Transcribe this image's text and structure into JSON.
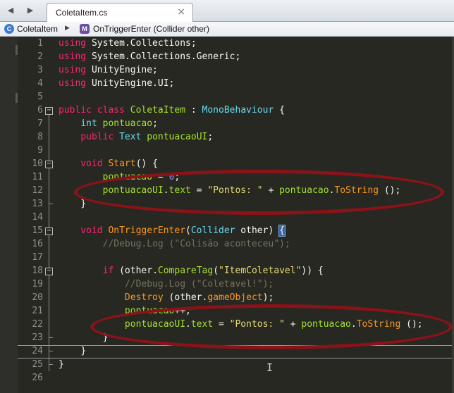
{
  "tab": {
    "title": "ColetaItem.cs",
    "close": "×"
  },
  "nav": {
    "back": "◀",
    "forward": "▶"
  },
  "breadcrumb": {
    "class_name": "ColetaItem",
    "separator": "▶",
    "method_name": "OnTriggerEnter (Collider other)"
  },
  "icons": {
    "class": "class-icon",
    "method": "method-icon"
  },
  "editor": {
    "line_numbers": [
      "1",
      "2",
      "3",
      "4",
      "5",
      "6",
      "7",
      "8",
      "9",
      "10",
      "11",
      "12",
      "13",
      "14",
      "15",
      "16",
      "17",
      "18",
      "19",
      "20",
      "21",
      "22",
      "23",
      "24",
      "25",
      "26"
    ],
    "fold_open": "−",
    "current_line": 24
  },
  "colors": {
    "background": "#272822",
    "keyword": "#f92672",
    "type": "#66d9ef",
    "call": "#a6e22e",
    "string": "#e6db74",
    "number": "#ae81ff",
    "comment": "#75715e",
    "highlight_ellipse": "#8b1219"
  },
  "code": {
    "l1": {
      "kw": "using",
      "rest": " System.Collections;"
    },
    "l2": {
      "kw": "using",
      "rest": " System.Collections.Generic;"
    },
    "l3": {
      "kw": "using",
      "rest": " UnityEngine;"
    },
    "l4": {
      "kw": "using",
      "rest": " UnityEngine.UI;"
    },
    "l6": {
      "kw1": "public",
      "kw2": " class",
      "sp": " ",
      "name": "ColetaItem",
      "colon": " : ",
      "base": "MonoBehaviour",
      "brace": " {"
    },
    "l7": {
      "indent": "    ",
      "type": "int",
      "sp": " ",
      "field": "pontuacao",
      "end": ";"
    },
    "l8": {
      "indent": "    ",
      "kw": "public",
      "sp": " ",
      "type": "Text",
      "sp2": " ",
      "field": "pontuacaoUI",
      "end": ";"
    },
    "l10": {
      "indent": "    ",
      "type": "void",
      "sp": " ",
      "name": "Start",
      "rest": "() {"
    },
    "l11": {
      "indent": "        ",
      "field": "pontuacao",
      "op": " = ",
      "num": "0",
      "end": ";"
    },
    "l12": {
      "indent": "        ",
      "field": "pontuacaoUI",
      "dot": ".",
      "prop": "text",
      "op": " = ",
      "str": "\"Pontos: \"",
      "plus": " + ",
      "field2": "pontuacao",
      "dot2": ".",
      "call": "ToString",
      "end": " ();"
    },
    "l13": {
      "indent": "    ",
      "text": "}"
    },
    "l15": {
      "indent": "    ",
      "type": "void",
      "sp": " ",
      "name": "OnTriggerEnter",
      "open": "(",
      "ptype": "Collider",
      "param": " other",
      "close": ") ",
      "brace": "{"
    },
    "l16": {
      "indent": "        ",
      "comment": "//Debug.Log (\"Colisão aconteceu\");"
    },
    "l18": {
      "indent": "        ",
      "kw": "if",
      "pre": " (other.",
      "call": "CompareTag",
      "open": "(",
      "str": "\"ItemColetavel\"",
      "end": ")) {"
    },
    "l19": {
      "indent": "            ",
      "comment": "//Debug.Log (\"Coletavel!\");"
    },
    "l20": {
      "indent": "            ",
      "call": "Destroy",
      "pre": " (other.",
      "prop": "gameObject",
      "end": ");"
    },
    "l21": {
      "indent": "            ",
      "field": "pontuacao",
      "end": "++;"
    },
    "l22": {
      "indent": "            ",
      "field": "pontuacaoUI",
      "dot": ".",
      "prop": "text",
      "op": " = ",
      "str": "\"Pontos: \"",
      "plus": " + ",
      "field2": "pontuacao",
      "dot2": ".",
      "call": "ToString",
      "end": " ();"
    },
    "l23": {
      "indent": "        ",
      "text": "}"
    },
    "l24": {
      "indent": "    ",
      "text": "}"
    },
    "l25": {
      "text": "}"
    }
  }
}
